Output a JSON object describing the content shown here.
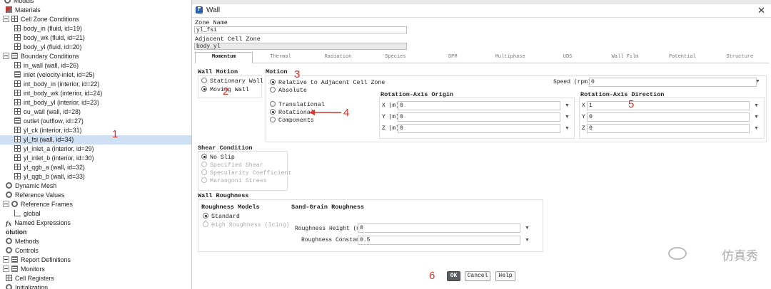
{
  "tree": {
    "items": [
      {
        "label": "Models",
        "icon": "model-icon",
        "kind": "header"
      },
      {
        "label": "Materials",
        "icon": "materials-icon",
        "kind": "item"
      },
      {
        "label": "Cell Zone Conditions",
        "icon": "cell-zone-icon",
        "kind": "group"
      },
      {
        "label": "body_in (fluid, id=19)",
        "icon": "zone-icon",
        "kind": "child"
      },
      {
        "label": "body_wk (fluid, id=21)",
        "icon": "zone-icon",
        "kind": "child"
      },
      {
        "label": "body_yl (fluid, id=20)",
        "icon": "zone-icon",
        "kind": "child"
      },
      {
        "label": "Boundary Conditions",
        "icon": "boundary-icon",
        "kind": "group"
      },
      {
        "label": "in_wall (wall, id=26)",
        "icon": "wall-icon",
        "kind": "child"
      },
      {
        "label": "inlet (velocity-inlet, id=25)",
        "icon": "inlet-icon",
        "kind": "child"
      },
      {
        "label": "int_body_in (interior, id=22)",
        "icon": "interior-icon",
        "kind": "child"
      },
      {
        "label": "int_body_wk (interior, id=24)",
        "icon": "interior-icon",
        "kind": "child"
      },
      {
        "label": "int_body_yl (interior, id=23)",
        "icon": "interior-icon",
        "kind": "child"
      },
      {
        "label": "ou_wall (wall, id=28)",
        "icon": "wall-icon",
        "kind": "child"
      },
      {
        "label": "outlet (outflow, id=27)",
        "icon": "outlet-icon",
        "kind": "child"
      },
      {
        "label": "yl_ck (interior, id=31)",
        "icon": "interior-icon",
        "kind": "child"
      },
      {
        "label": "yl_fsi (wall, id=34)",
        "icon": "wall-icon",
        "kind": "child",
        "selected": true
      },
      {
        "label": "yl_inlet_a (interior, id=29)",
        "icon": "interior-icon",
        "kind": "child"
      },
      {
        "label": "yl_inlet_b (interior, id=30)",
        "icon": "interior-icon",
        "kind": "child"
      },
      {
        "label": "yl_qgb_a (wall, id=32)",
        "icon": "wall-icon",
        "kind": "child"
      },
      {
        "label": "yl_qgb_b (wall, id=33)",
        "icon": "wall-icon",
        "kind": "child"
      },
      {
        "label": "Dynamic Mesh",
        "icon": "dynamic-mesh-icon",
        "kind": "item"
      },
      {
        "label": "Reference Values",
        "icon": "reference-values-icon",
        "kind": "item"
      },
      {
        "label": "Reference Frames",
        "icon": "reference-frames-icon",
        "kind": "group"
      },
      {
        "label": "global",
        "icon": "axis-icon",
        "kind": "child2"
      },
      {
        "label": "Named Expressions",
        "icon": "fx-icon",
        "kind": "item"
      },
      {
        "label": "olution",
        "icon": "",
        "kind": "section"
      },
      {
        "label": "Methods",
        "icon": "methods-icon",
        "kind": "item"
      },
      {
        "label": "Controls",
        "icon": "controls-icon",
        "kind": "item"
      },
      {
        "label": "Report Definitions",
        "icon": "report-icon",
        "kind": "group"
      },
      {
        "label": "Monitors",
        "icon": "monitors-icon",
        "kind": "group"
      },
      {
        "label": "Cell Registers",
        "icon": "cell-registers-icon",
        "kind": "item"
      },
      {
        "label": "Initialization",
        "icon": "initialization-icon",
        "kind": "item"
      }
    ]
  },
  "dialog": {
    "title": "Wall",
    "zone_name_label": "Zone Name",
    "zone_name_value": "yl_fsi",
    "adjacent_label": "Adjacent Cell Zone",
    "adjacent_value": "body_yl",
    "tabs": [
      "Momentum",
      "Thermal",
      "Radiation",
      "Species",
      "DPM",
      "Multiphase",
      "UDS",
      "Wall Film",
      "Potential",
      "Structure"
    ],
    "active_tab": "Momentum",
    "wall_motion": {
      "title": "Wall Motion",
      "options": [
        "Stationary Wall",
        "Moving Wall"
      ],
      "selected": "Moving Wall"
    },
    "motion": {
      "title": "Motion",
      "frame_options": [
        "Relative to Adjacent Cell Zone",
        "Absolute"
      ],
      "frame_selected": "Relative to Adjacent Cell Zone",
      "type_options": [
        "Translational",
        "Rotational",
        "Components"
      ],
      "type_selected": "Rotational",
      "speed_label": "Speed (rpm)",
      "speed_value": "0",
      "origin_title": "Rotation-Axis Origin",
      "origin": [
        {
          "label": "X (m)",
          "value": "0"
        },
        {
          "label": "Y (m)",
          "value": "0"
        },
        {
          "label": "Z (m)",
          "value": "0"
        }
      ],
      "direction_title": "Rotation-Axis Direction",
      "direction": [
        {
          "label": "X",
          "value": "1"
        },
        {
          "label": "Y",
          "value": "0"
        },
        {
          "label": "Z",
          "value": "0"
        }
      ]
    },
    "shear": {
      "title": "Shear Condition",
      "options": [
        "No Slip",
        "Specified Shear",
        "Specularity Coefficient",
        "Marangoni Stress"
      ],
      "selected": "No Slip"
    },
    "roughness": {
      "title": "Wall Roughness",
      "models_title": "Roughness Models",
      "models": [
        "Standard",
        "High Roughness (Icing)"
      ],
      "model_selected": "Standard",
      "sand_title": "Sand-Grain Roughness",
      "height_label": "Roughness Height (m)",
      "height_value": "0",
      "constant_label": "Roughness Constant",
      "constant_value": "0.5"
    },
    "buttons": {
      "ok": "OK",
      "cancel": "Cancel",
      "help": "Help"
    }
  },
  "annotations": [
    "1",
    "2",
    "3",
    "4",
    "5",
    "6"
  ],
  "watermark": "仿真秀",
  "colors": {
    "annotation": "#d9312a",
    "selection": "#cfe0f3",
    "ok_button": "#5a5f66"
  }
}
